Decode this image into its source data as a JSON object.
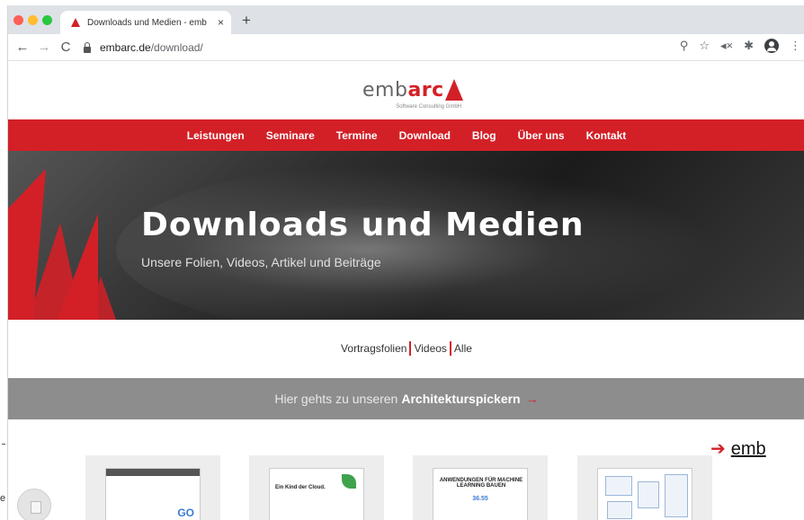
{
  "browser": {
    "tab_title": "Downloads und Medien - emb",
    "tab_close": "×",
    "new_tab": "+",
    "url_host": "embarc.de",
    "url_path": "/download/",
    "nav_back": "←",
    "nav_forward": "→",
    "nav_reload": "C",
    "toolbar_icons": [
      "zoom-icon",
      "bookmark-star-icon",
      "mute-icon",
      "extensions-icon",
      "profile-icon",
      "menu-icon"
    ]
  },
  "site": {
    "logo": {
      "prefix": "emb",
      "accent": "arc",
      "tagline": "Software Consulting GmbH"
    },
    "nav": [
      "Leistungen",
      "Seminare",
      "Termine",
      "Download",
      "Blog",
      "Über uns",
      "Kontakt"
    ],
    "hero": {
      "title": "Downloads und Medien",
      "subtitle": "Unsere Folien, Videos, Artikel und Beiträge"
    },
    "filters": [
      "Vortragsfolien",
      "Videos",
      "Alle"
    ],
    "cta": {
      "prefix": "Hier gehts zu unseren",
      "highlight": "Architekturspickern",
      "arrow": "→"
    },
    "cards": [
      {
        "text": "GO"
      },
      {
        "text": "Ein Kind der Cloud."
      },
      {
        "text": "ANWENDUNGEN FÜR MACHINE LEARNING BAUEN",
        "number": "36.55"
      },
      {
        "text": ""
      }
    ]
  },
  "external": {
    "link_arrow": "➔",
    "link_text": "emb",
    "left_fragment": "e"
  },
  "colors": {
    "brand_red": "#d32027",
    "band_gray": "#8d8d8d",
    "tab_strip": "#dee1e6"
  }
}
